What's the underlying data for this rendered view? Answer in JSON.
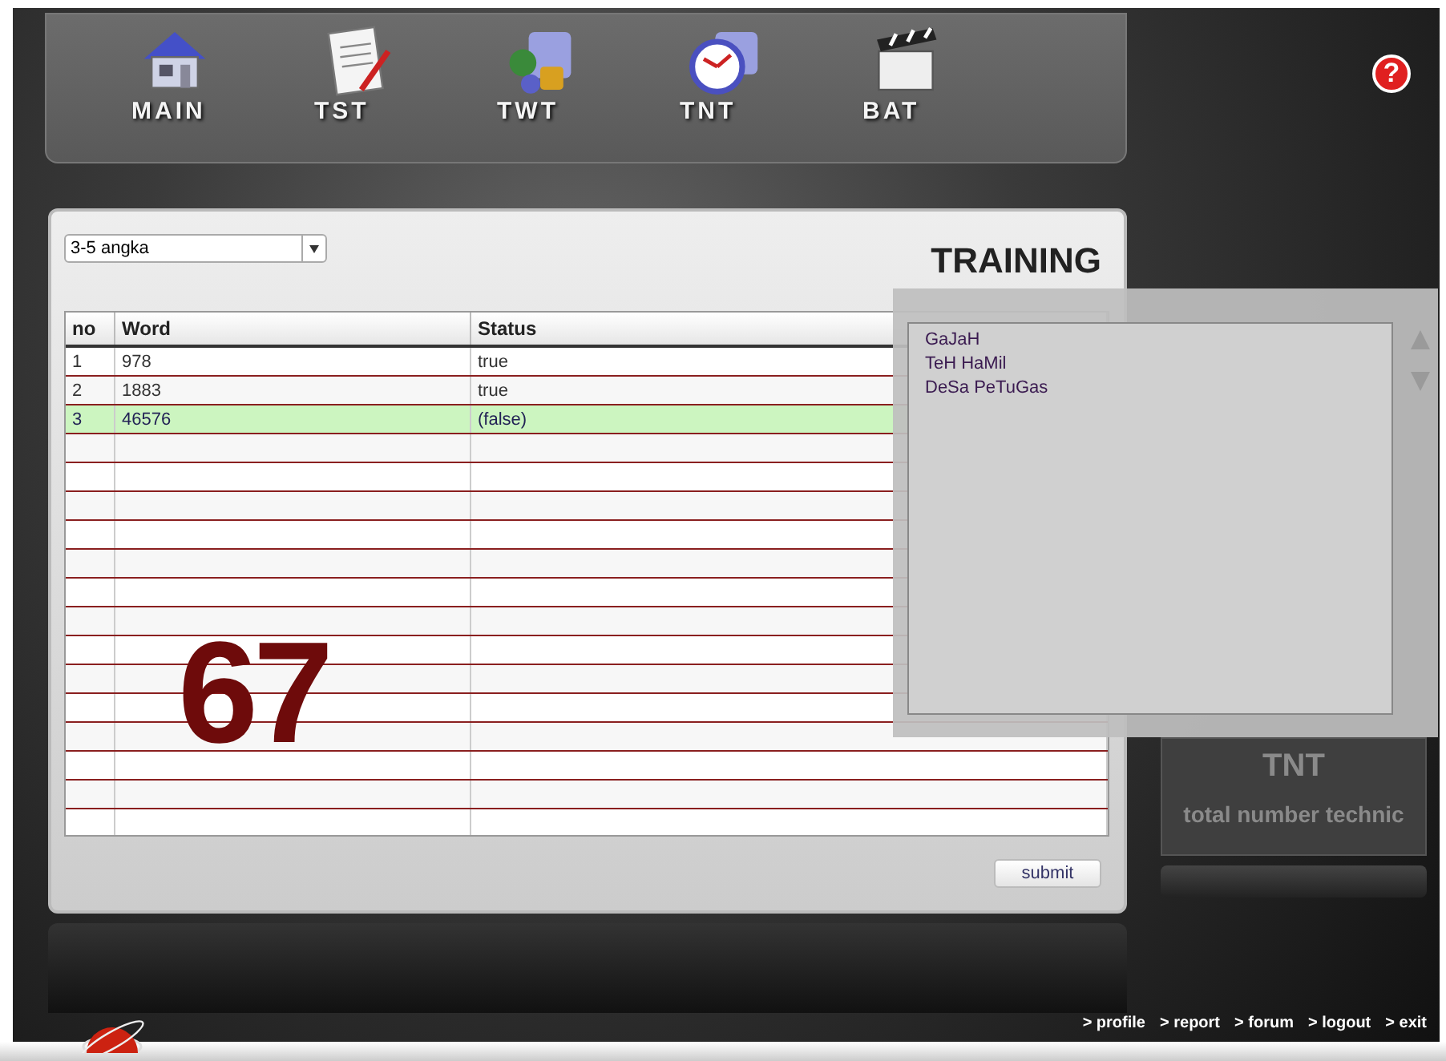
{
  "nav": [
    {
      "label": "MAIN"
    },
    {
      "label": "TST"
    },
    {
      "label": "TWT"
    },
    {
      "label": "TNT"
    },
    {
      "label": "BAT"
    }
  ],
  "help": {
    "label": "?"
  },
  "dropdown": {
    "value": "3-5 angka"
  },
  "title": "TRAINING",
  "table": {
    "columns": [
      "no",
      "Word",
      "Status"
    ],
    "rows": [
      {
        "cells": [
          "1",
          "978",
          "true"
        ],
        "selected": false
      },
      {
        "cells": [
          "2",
          "1883",
          "true"
        ],
        "selected": false
      },
      {
        "cells": [
          "3",
          "46576",
          "(false)"
        ],
        "selected": true
      }
    ]
  },
  "score": "67",
  "word_list": {
    "items": [
      "GaJaH",
      "TeH HaMil",
      "DeSa PeTuGas"
    ]
  },
  "submit": "submit",
  "info_card": {
    "title": "TNT",
    "subtitle": "total number technic"
  },
  "footer_links": [
    "> profile",
    "> report",
    "> forum",
    "> logout",
    "> exit"
  ]
}
